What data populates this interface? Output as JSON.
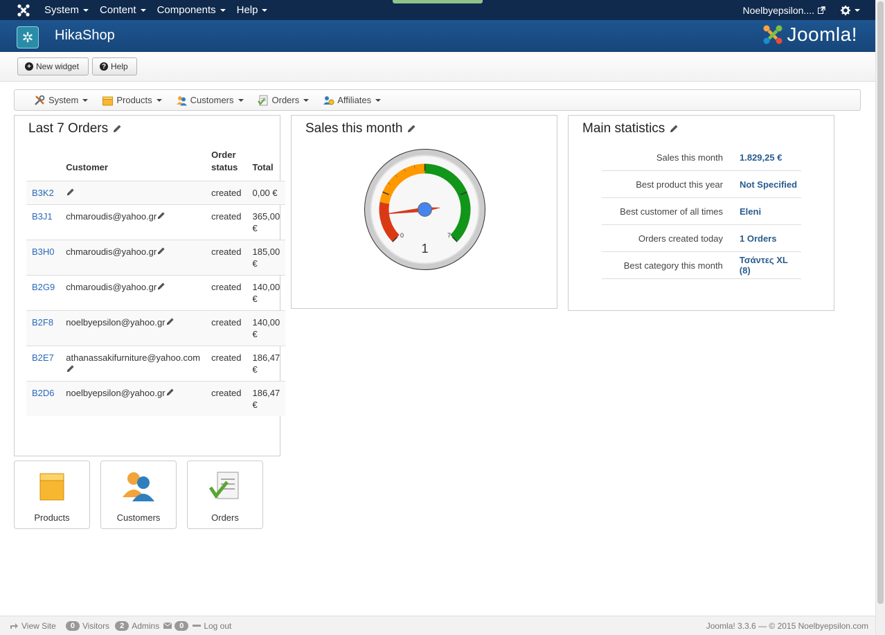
{
  "topnav": {
    "menu": [
      "System",
      "Content",
      "Components",
      "Help"
    ],
    "user": "Noelbyepsilon....",
    "icons": [
      "joomla-logo-icon",
      "external-link-icon",
      "gear-icon"
    ]
  },
  "header": {
    "title": "HikaShop",
    "brand": "Joomla!"
  },
  "toolbar": {
    "new_widget": "New widget",
    "help": "Help"
  },
  "hikamenu": {
    "items": [
      "System",
      "Products",
      "Customers",
      "Orders",
      "Affiliates"
    ]
  },
  "last_orders": {
    "title": "Last 7 Orders",
    "headers": {
      "customer": "Customer",
      "status_line1": "Order",
      "status_line2": "status",
      "total": "Total"
    },
    "rows": [
      {
        "num": "B3K2",
        "customer": "",
        "status": "created",
        "total": "0,00 €"
      },
      {
        "num": "B3J1",
        "customer": "chmaroudis@yahoo.gr",
        "status": "created",
        "total": "365,00 €"
      },
      {
        "num": "B3H0",
        "customer": "chmaroudis@yahoo.gr",
        "status": "created",
        "total": "185,00 €"
      },
      {
        "num": "B2G9",
        "customer": "chmaroudis@yahoo.gr",
        "status": "created",
        "total": "140,00 €"
      },
      {
        "num": "B2F8",
        "customer": "noelbyepsilon@yahoo.gr",
        "status": "created",
        "total": "140,00 €"
      },
      {
        "num": "B2E7",
        "customer": "athanassakifurniture@yahoo.com",
        "status": "created",
        "total": "186,47 €"
      },
      {
        "num": "B2D6",
        "customer": "noelbyepsilon@yahoo.gr",
        "status": "created",
        "total": "186,47 €"
      }
    ]
  },
  "sales_month": {
    "title": "Sales this month",
    "gauge": {
      "min": "0",
      "max": "7",
      "value": "1",
      "colors": {
        "red": "#dc3912",
        "orange": "#ff9900",
        "green": "#109618",
        "needle": "#dc3912",
        "hub": "#4684ee"
      }
    }
  },
  "main_stats": {
    "title": "Main statistics",
    "rows": [
      {
        "label": "Sales this month",
        "value": "1.829,25 €"
      },
      {
        "label": "Best product this year",
        "value": "Not Specified"
      },
      {
        "label": "Best customer of all times",
        "value": "Eleni"
      },
      {
        "label": "Orders created today",
        "value": "1 Orders"
      },
      {
        "label": "Best category this month",
        "value": "Τσάντες XL (8)"
      }
    ]
  },
  "tiles": [
    {
      "label": "Products",
      "icon": "box-icon"
    },
    {
      "label": "Customers",
      "icon": "users-icon"
    },
    {
      "label": "Orders",
      "icon": "orders-document-icon"
    }
  ],
  "footer": {
    "view_site": "View Site",
    "visitors_count": "0",
    "visitors": "Visitors",
    "admins_count": "2",
    "admins": "Admins",
    "messages_count": "0",
    "logout": "Log out",
    "copyright": "Joomla! 3.3.6  — © 2015 Noelbyepsilon.com"
  }
}
